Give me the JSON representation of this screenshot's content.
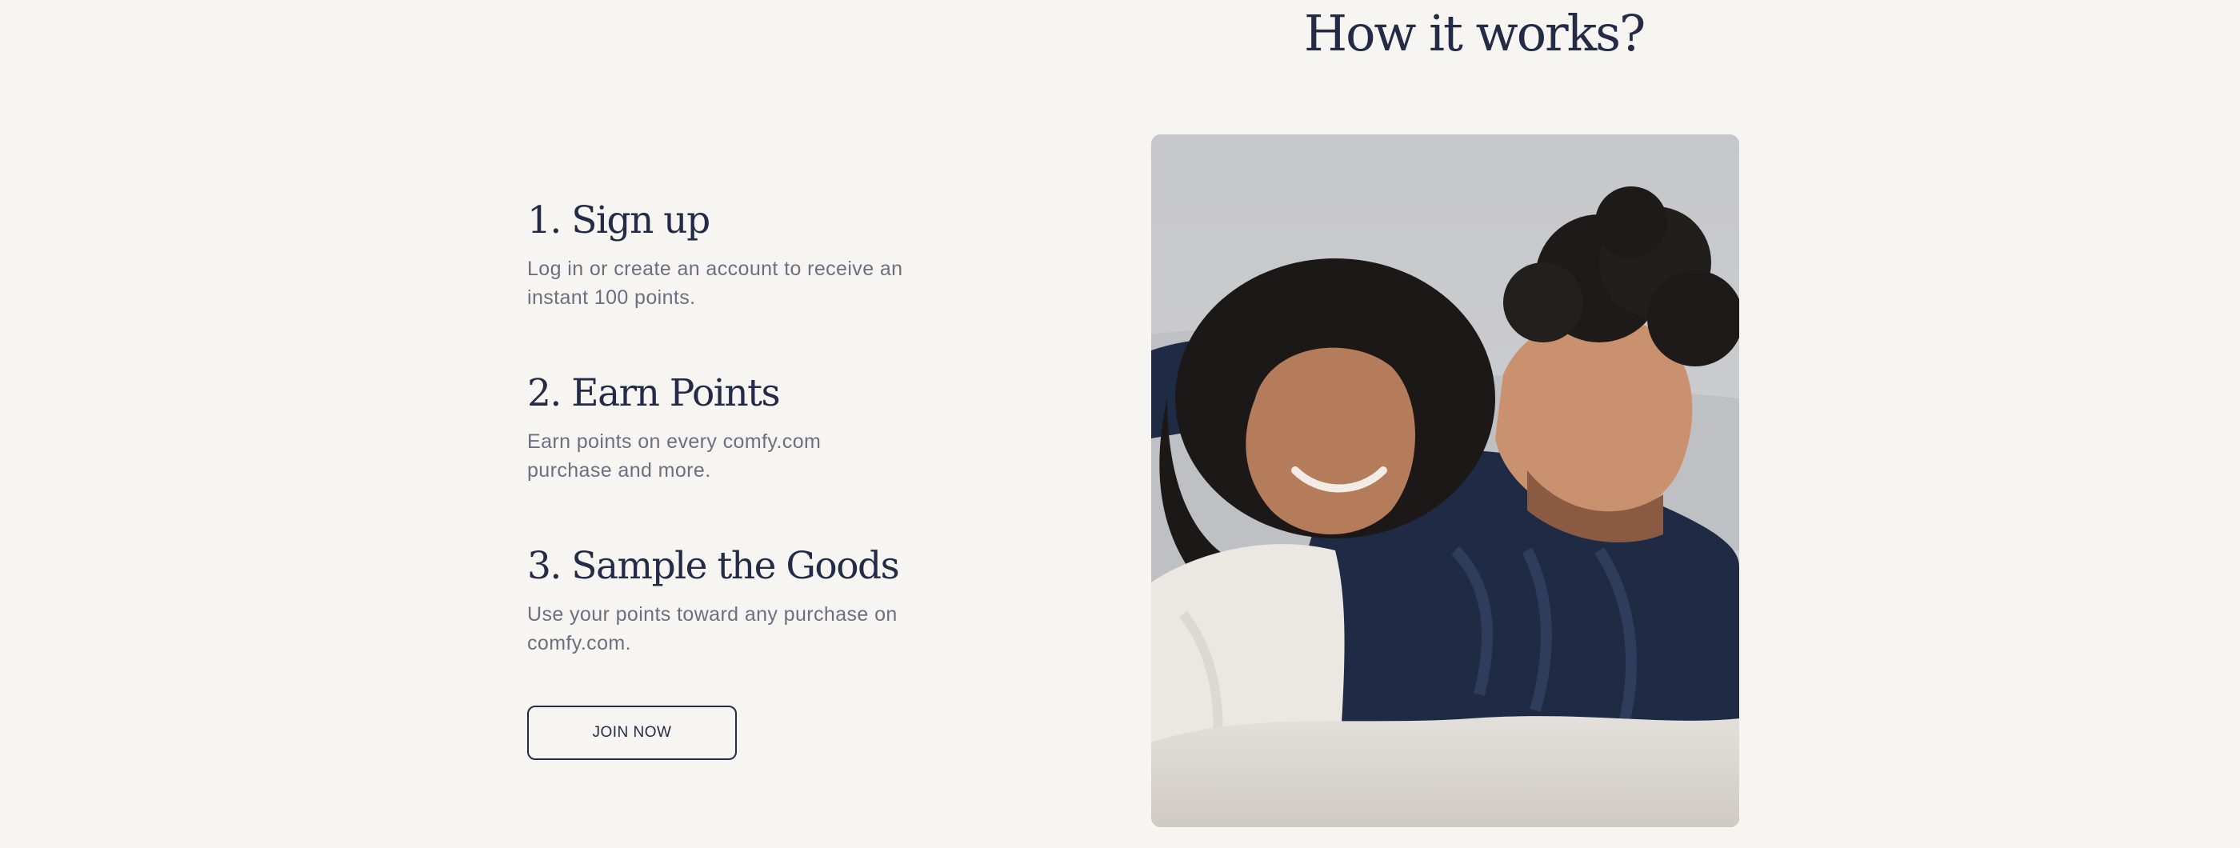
{
  "section": {
    "title": "How it works?"
  },
  "steps": [
    {
      "title": "1. Sign up",
      "description": "Log in or create an account to receive an instant 100 points."
    },
    {
      "title": "2. Earn Points",
      "description": "Earn points on every comfy.com purchase and more."
    },
    {
      "title": "3. Sample the Goods",
      "description": "Use your points toward any purchase on comfy.com."
    }
  ],
  "cta": {
    "label": "JOIN NOW"
  },
  "colors": {
    "background": "#f7f5f2",
    "heading": "#232b46",
    "body_text": "#6b6f7f",
    "button_border": "#232b46"
  }
}
